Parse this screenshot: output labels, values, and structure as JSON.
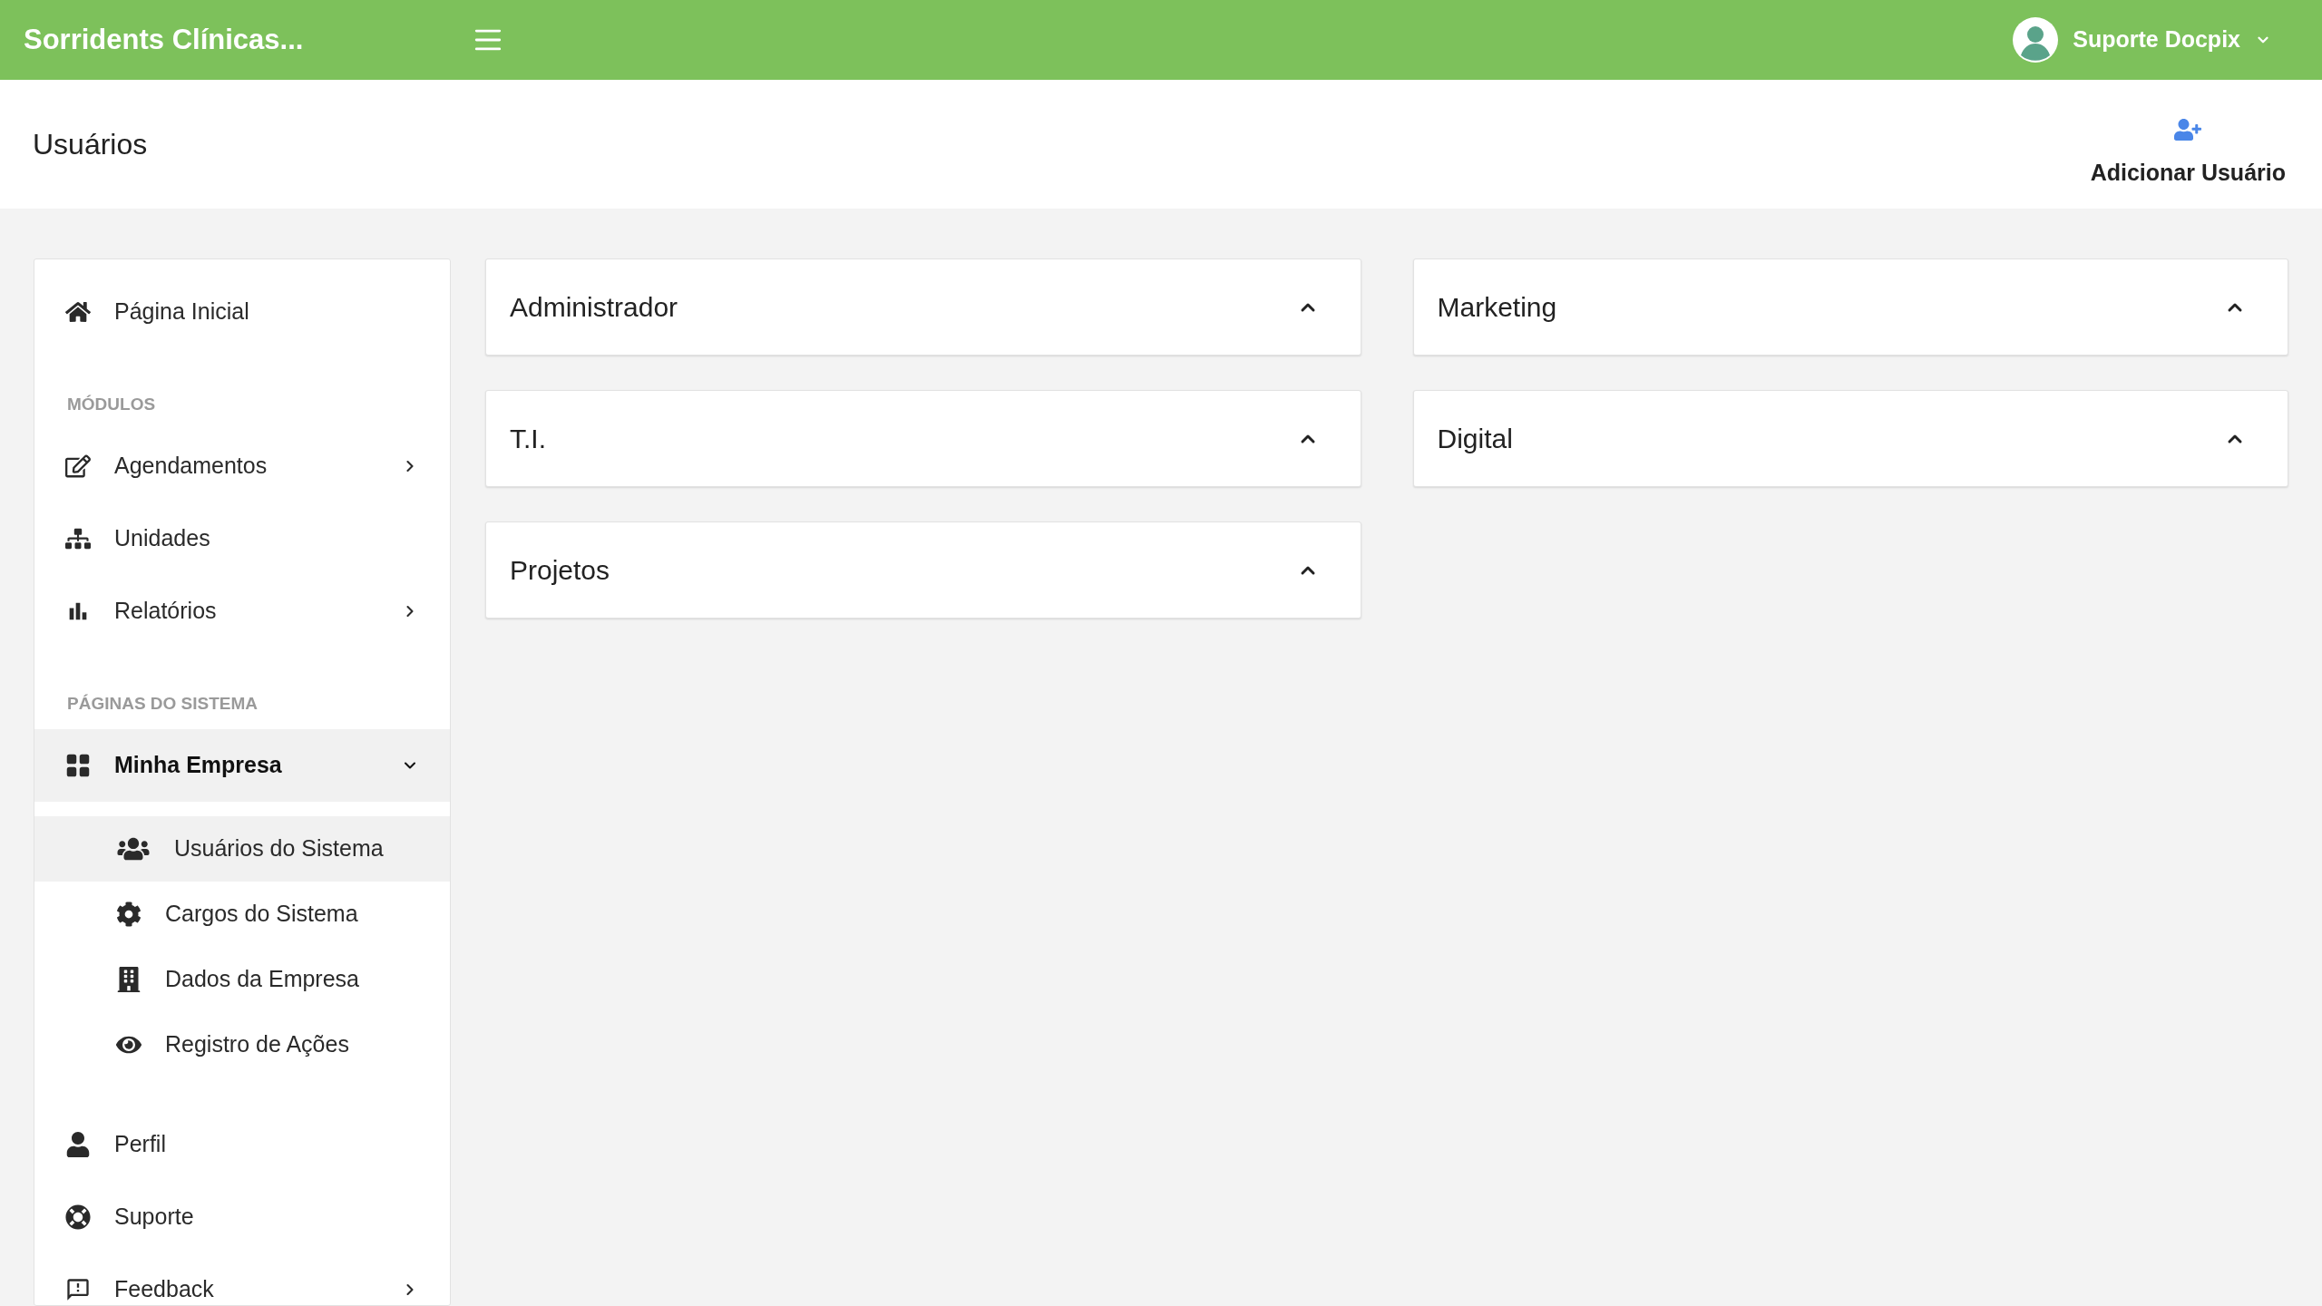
{
  "topbar": {
    "brand": "Sorridents Clínicas...",
    "user": "Suporte Docpix"
  },
  "header": {
    "title": "Usuários",
    "add_button": "Adicionar Usuário"
  },
  "sidebar": {
    "items": [
      {
        "kind": "link",
        "label": "Página Inicial"
      },
      {
        "kind": "section",
        "label": "MÓDULOS"
      },
      {
        "kind": "menu",
        "label": "Agendamentos",
        "expanded": false
      },
      {
        "kind": "link",
        "label": "Unidades"
      },
      {
        "kind": "menu",
        "label": "Relatórios",
        "expanded": false
      },
      {
        "kind": "section",
        "label": "PÁGINAS DO SISTEMA"
      },
      {
        "kind": "menu",
        "label": "Minha Empresa",
        "expanded": true,
        "children": [
          {
            "label": "Usuários do Sistema",
            "selected": true
          },
          {
            "label": "Cargos do Sistema",
            "selected": false
          },
          {
            "label": "Dados da Empresa",
            "selected": false
          },
          {
            "label": "Registro de Ações",
            "selected": false
          }
        ]
      },
      {
        "kind": "link",
        "label": "Perfil"
      },
      {
        "kind": "link",
        "label": "Suporte"
      },
      {
        "kind": "menu",
        "label": "Feedback",
        "expanded": false
      }
    ]
  },
  "columns": [
    {
      "groups": [
        {
          "title": "Administrador"
        },
        {
          "title": "T.I."
        },
        {
          "title": "Projetos"
        }
      ]
    },
    {
      "groups": [
        {
          "title": "Marketing"
        },
        {
          "title": "Digital"
        }
      ]
    }
  ]
}
